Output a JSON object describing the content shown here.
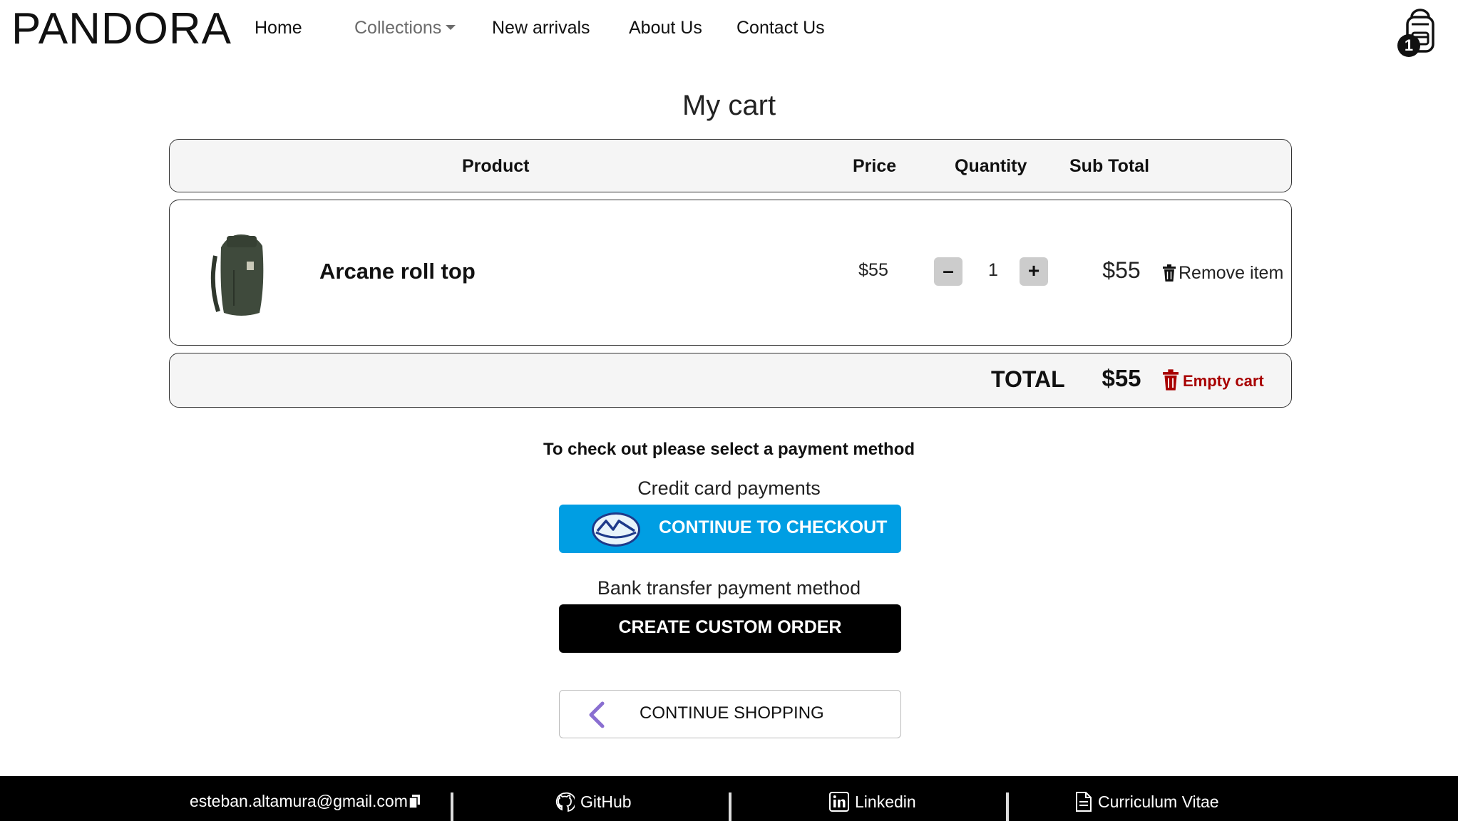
{
  "nav": {
    "logo": "PANDORA",
    "links": [
      {
        "label": "Home"
      },
      {
        "label": "Collections"
      },
      {
        "label": "New arrivals"
      },
      {
        "label": "About Us"
      },
      {
        "label": "Contact Us"
      }
    ],
    "cart_count": "1"
  },
  "page_title": "My cart",
  "table": {
    "headers": {
      "product": "Product",
      "price": "Price",
      "quantity": "Quantity",
      "subtotal": "Sub Total"
    },
    "items": [
      {
        "name": "Arcane roll top",
        "price": "$55",
        "quantity": "1",
        "subtotal": "$55",
        "remove_label": "Remove item"
      }
    ],
    "total_label": "TOTAL",
    "total_value": "$55",
    "empty_label": "Empty cart"
  },
  "checkout": {
    "hint": "To check out please select a payment method",
    "card_label": "Credit card payments",
    "card_button": "CONTINUE TO CHECKOUT",
    "bank_label": "Bank transfer payment method",
    "bank_button": "CREATE CUSTOM ORDER",
    "continue_button": "CONTINUE SHOPPING"
  },
  "footer": {
    "email": "esteban.altamura@gmail.com",
    "github": "GitHub",
    "linkedin": "Linkedin",
    "cv": "Curriculum Vitae"
  },
  "colors": {
    "mercadopago_blue": "#009ee3",
    "danger_red": "#a80000",
    "accent_purple": "#8a6fd1"
  }
}
